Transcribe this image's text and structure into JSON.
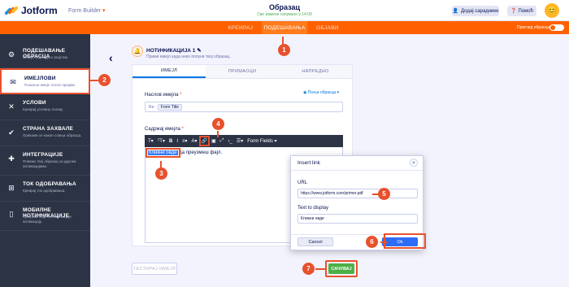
{
  "header": {
    "logo_text": "Jotform",
    "product": "Form Builder",
    "doc_title": "Образац",
    "doc_status": "Све измене сачуване у 14:09",
    "assign_label": "Додај сараднике",
    "help_label": "Помоћ"
  },
  "nav": {
    "tabs": [
      {
        "label": "КРЕИРАЈ"
      },
      {
        "label": "ПОДЕШАВАЊА"
      },
      {
        "label": "ОБЈАВИ"
      }
    ],
    "preview_label": "Преглед обрасца"
  },
  "sidebar": {
    "items": [
      {
        "title": "ПОДЕШАВАЊЕ ОБРАСЦА",
        "subtitle": "Статус обрасца и својства"
      },
      {
        "title": "ИМЕЈЛОВИ",
        "subtitle": "Пошаљи имејл после пријаве."
      },
      {
        "title": "УСЛОВИ",
        "subtitle": "Креирај условну логику."
      },
      {
        "title": "СТРАНА ЗАХВАЛЕ",
        "subtitle": "Прикажи се након слања обрасца."
      },
      {
        "title": "ИНТЕГРАЦИЈЕ",
        "subtitle": "Повежи твој образац са другим апликацијама."
      },
      {
        "title": "ТОК ОДОБРАВАЊА",
        "subtitle": "Креирај ток одобравања."
      },
      {
        "title": "МОБИЛНЕ НОТИФИКАЦИЈЕ",
        "subtitle": "Преузми твоје нотификације апликацију."
      }
    ]
  },
  "panel": {
    "title": "НОТИФИКАЦИЈА 1",
    "subtitle": "Прими имејл када неко попуни твој образац.",
    "tabs": [
      {
        "label": "ИМЕЈЛ"
      },
      {
        "label": "ПРИМАОЦИ"
      },
      {
        "label": "НАПРЕДНО"
      }
    ],
    "subject_label": "Наслов имејла",
    "from_form_label": "Поља обрасца",
    "subject_prefix": "Re:",
    "subject_chip": "Form Title",
    "content_label": "Садржај имејла",
    "form_fields_label": "Form Fields",
    "selected_text": "Кликни овде",
    "body_rest": "да преузмеш фајл.",
    "test_label": "ТЕСТИРАЈ ИМЕЈЛ",
    "save_label": "САЧУВАЈ"
  },
  "dialog": {
    "title": "Insert link",
    "url_label": "URL",
    "url_value": "https://www.jotform.com/primer.pdf",
    "text_label": "Text to display",
    "text_value": "Кликни овде",
    "cancel_label": "Cancel",
    "ok_label": "Ok"
  },
  "callouts": [
    "1",
    "2",
    "3",
    "4",
    "5",
    "6",
    "7"
  ],
  "colors": {
    "brand_orange": "#ff6100",
    "sidebar_bg": "#2c3345",
    "callout": "#e8512c",
    "save_green": "#4db047",
    "ok_blue": "#2f6cf6"
  }
}
